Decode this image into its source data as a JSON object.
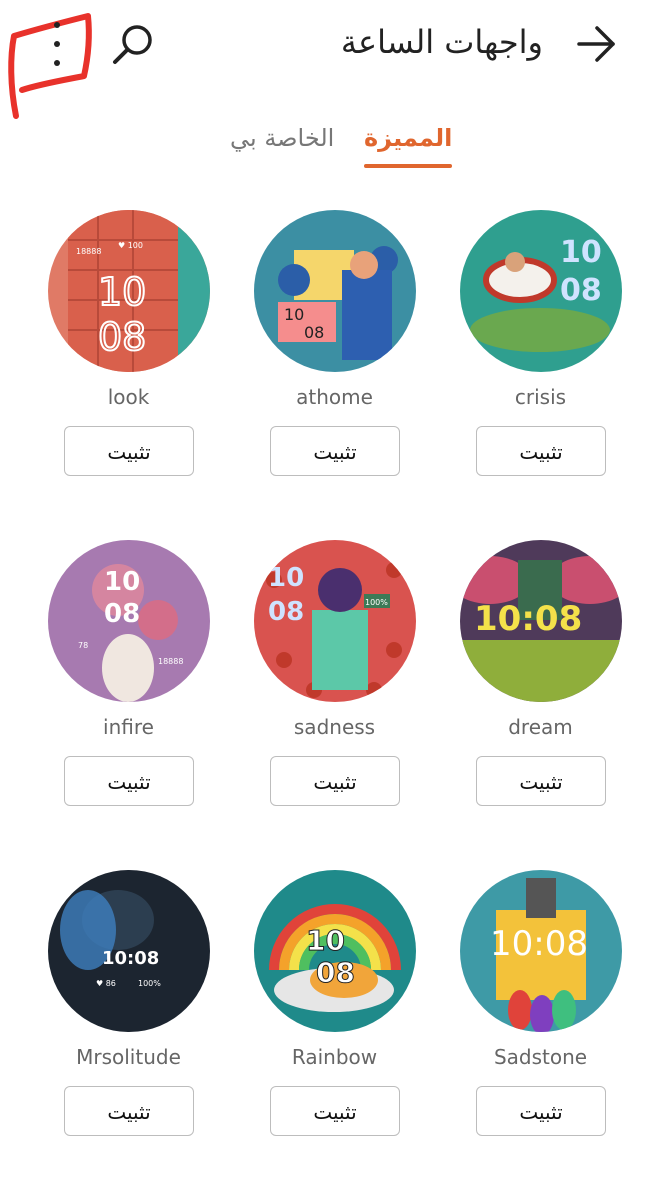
{
  "header": {
    "title": "واجهات الساعة",
    "back_icon": "arrow-right-icon",
    "search_icon": "search-icon",
    "menu_icon": "more-vertical-icon"
  },
  "tabs": [
    {
      "label": "المميزة",
      "active": true
    },
    {
      "label": "الخاصة بي",
      "active": false
    }
  ],
  "accent_color": "#e0662e",
  "faces": [
    {
      "name": "crisis",
      "button": "تثبيت",
      "time": "10 08"
    },
    {
      "name": "athome",
      "button": "تثبيت",
      "time": "10 08"
    },
    {
      "name": "look",
      "button": "تثبيت",
      "time": "10 08",
      "steps": "18888",
      "heart": "100"
    },
    {
      "name": "dream",
      "button": "تثبيت",
      "time": "10:08"
    },
    {
      "name": "sadness",
      "button": "تثبيت",
      "time": "10 08",
      "battery": "100%"
    },
    {
      "name": "infire",
      "button": "تثبيت",
      "time": "10 08",
      "heart": "78",
      "steps": "18888"
    },
    {
      "name": "Sadstone",
      "button": "تثبيت",
      "time": "10:08"
    },
    {
      "name": "Rainbow",
      "button": "تثبيت",
      "time": "10 08"
    },
    {
      "name": "Mrsolitude",
      "button": "تثبيت",
      "time": "10:08",
      "heart": "86",
      "battery": "100%"
    }
  ]
}
